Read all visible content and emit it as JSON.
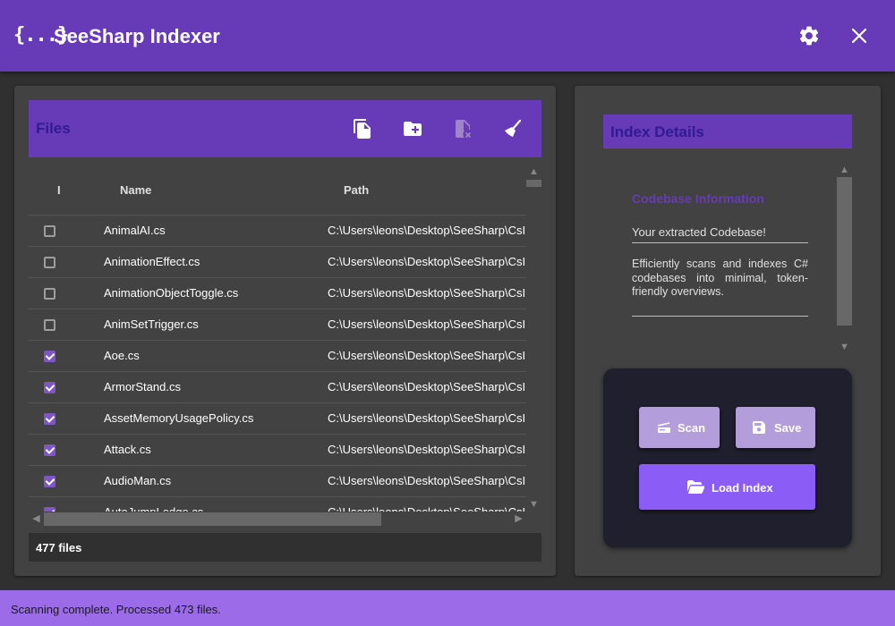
{
  "app": {
    "icon_text": "{...}",
    "title": "SeeSharp Indexer"
  },
  "files_panel": {
    "title": "Files",
    "columns": {
      "include": "I",
      "name": "Name",
      "path": "Path"
    },
    "rows": [
      {
        "name": "AnimalAI.cs",
        "path": "C:\\Users\\leons\\Desktop\\SeeSharp\\CsI",
        "checked": false
      },
      {
        "name": "AnimationEffect.cs",
        "path": "C:\\Users\\leons\\Desktop\\SeeSharp\\CsI",
        "checked": false
      },
      {
        "name": "AnimationObjectToggle.cs",
        "path": "C:\\Users\\leons\\Desktop\\SeeSharp\\CsI",
        "checked": false
      },
      {
        "name": "AnimSetTrigger.cs",
        "path": "C:\\Users\\leons\\Desktop\\SeeSharp\\CsI",
        "checked": false
      },
      {
        "name": "Aoe.cs",
        "path": "C:\\Users\\leons\\Desktop\\SeeSharp\\CsI",
        "checked": true
      },
      {
        "name": "ArmorStand.cs",
        "path": "C:\\Users\\leons\\Desktop\\SeeSharp\\CsI",
        "checked": true
      },
      {
        "name": "AssetMemoryUsagePolicy.cs",
        "path": "C:\\Users\\leons\\Desktop\\SeeSharp\\CsI",
        "checked": true
      },
      {
        "name": "Attack.cs",
        "path": "C:\\Users\\leons\\Desktop\\SeeSharp\\CsI",
        "checked": true
      },
      {
        "name": "AudioMan.cs",
        "path": "C:\\Users\\leons\\Desktop\\SeeSharp\\CsI",
        "checked": true
      },
      {
        "name": "AutoJumpLedge.cs",
        "path": "C:\\Users\\leons\\Desktop\\SeeSharp\\CsI",
        "checked": true
      }
    ],
    "footer_count": "477 files"
  },
  "details_panel": {
    "title": "Index Details",
    "info_heading": "Codebase Information",
    "codebase_value": "Your extracted Codebase!",
    "description": "Efficiently scans and indexes C# codebases into minimal, token-friendly overviews."
  },
  "actions": {
    "scan_label": "Scan",
    "save_label": "Save",
    "load_label": "Load Index"
  },
  "status": {
    "text": "Scanning complete. Processed 473 files."
  },
  "icons": {
    "app": "code-braces-icon",
    "settings": "gear-icon",
    "close": "close-icon",
    "add_file": "file-add-icon",
    "add_folder": "folder-add-icon",
    "remove_file": "file-remove-icon",
    "clear": "broom-icon",
    "scan": "scanner-icon",
    "save": "floppy-disk-icon",
    "load": "folder-open-icon"
  },
  "colors": {
    "primary": "#673ab7",
    "primary_dark": "#311b92",
    "accent_light": "#b39ddb",
    "accent_button": "#8b5cf6",
    "status_bar": "#9c6ce8",
    "panel": "#424242",
    "background": "#303030"
  }
}
